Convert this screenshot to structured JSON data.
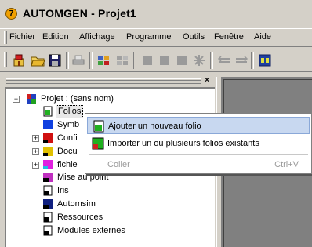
{
  "window": {
    "logo_text": "7",
    "title": "AUTOMGEN - Projet1"
  },
  "menu": {
    "items": [
      "Fichier",
      "Edition",
      "Affichage",
      "Programme",
      "Outils",
      "Fenêtre",
      "Aide"
    ]
  },
  "toolbar": {
    "buttons": [
      "new-project-icon",
      "open-folder-icon",
      "save-icon",
      "print-icon",
      "compile-icon",
      "run-icon",
      "stop-icon",
      "step-icon",
      "pause-icon",
      "connect-icon",
      "watch-icon",
      "monitor-icon",
      "go-icon"
    ]
  },
  "panel": {
    "close_glyph": "×"
  },
  "tree": {
    "root": "Projet : (sans nom)",
    "items": [
      {
        "label": "Folios",
        "expander": ""
      },
      {
        "label": "Symb",
        "expander": ""
      },
      {
        "label": "Confi",
        "expander": "+"
      },
      {
        "label": "Docu",
        "expander": "+"
      },
      {
        "label": "fichie",
        "expander": "+"
      },
      {
        "label": "Mise au point",
        "expander": ""
      },
      {
        "label": "Iris",
        "expander": ""
      },
      {
        "label": "Automsim",
        "expander": ""
      },
      {
        "label": "Ressources",
        "expander": ""
      },
      {
        "label": "Modules externes",
        "expander": ""
      }
    ]
  },
  "context_menu": {
    "add_folio": "Ajouter un nouveau folio",
    "import_folios": "Importer un ou plusieurs folios existants",
    "paste": "Coller",
    "paste_shortcut": "Ctrl+V"
  },
  "colors": {
    "window_bg": "#d4d0c8",
    "selection_bg": "#c8d8f0"
  }
}
